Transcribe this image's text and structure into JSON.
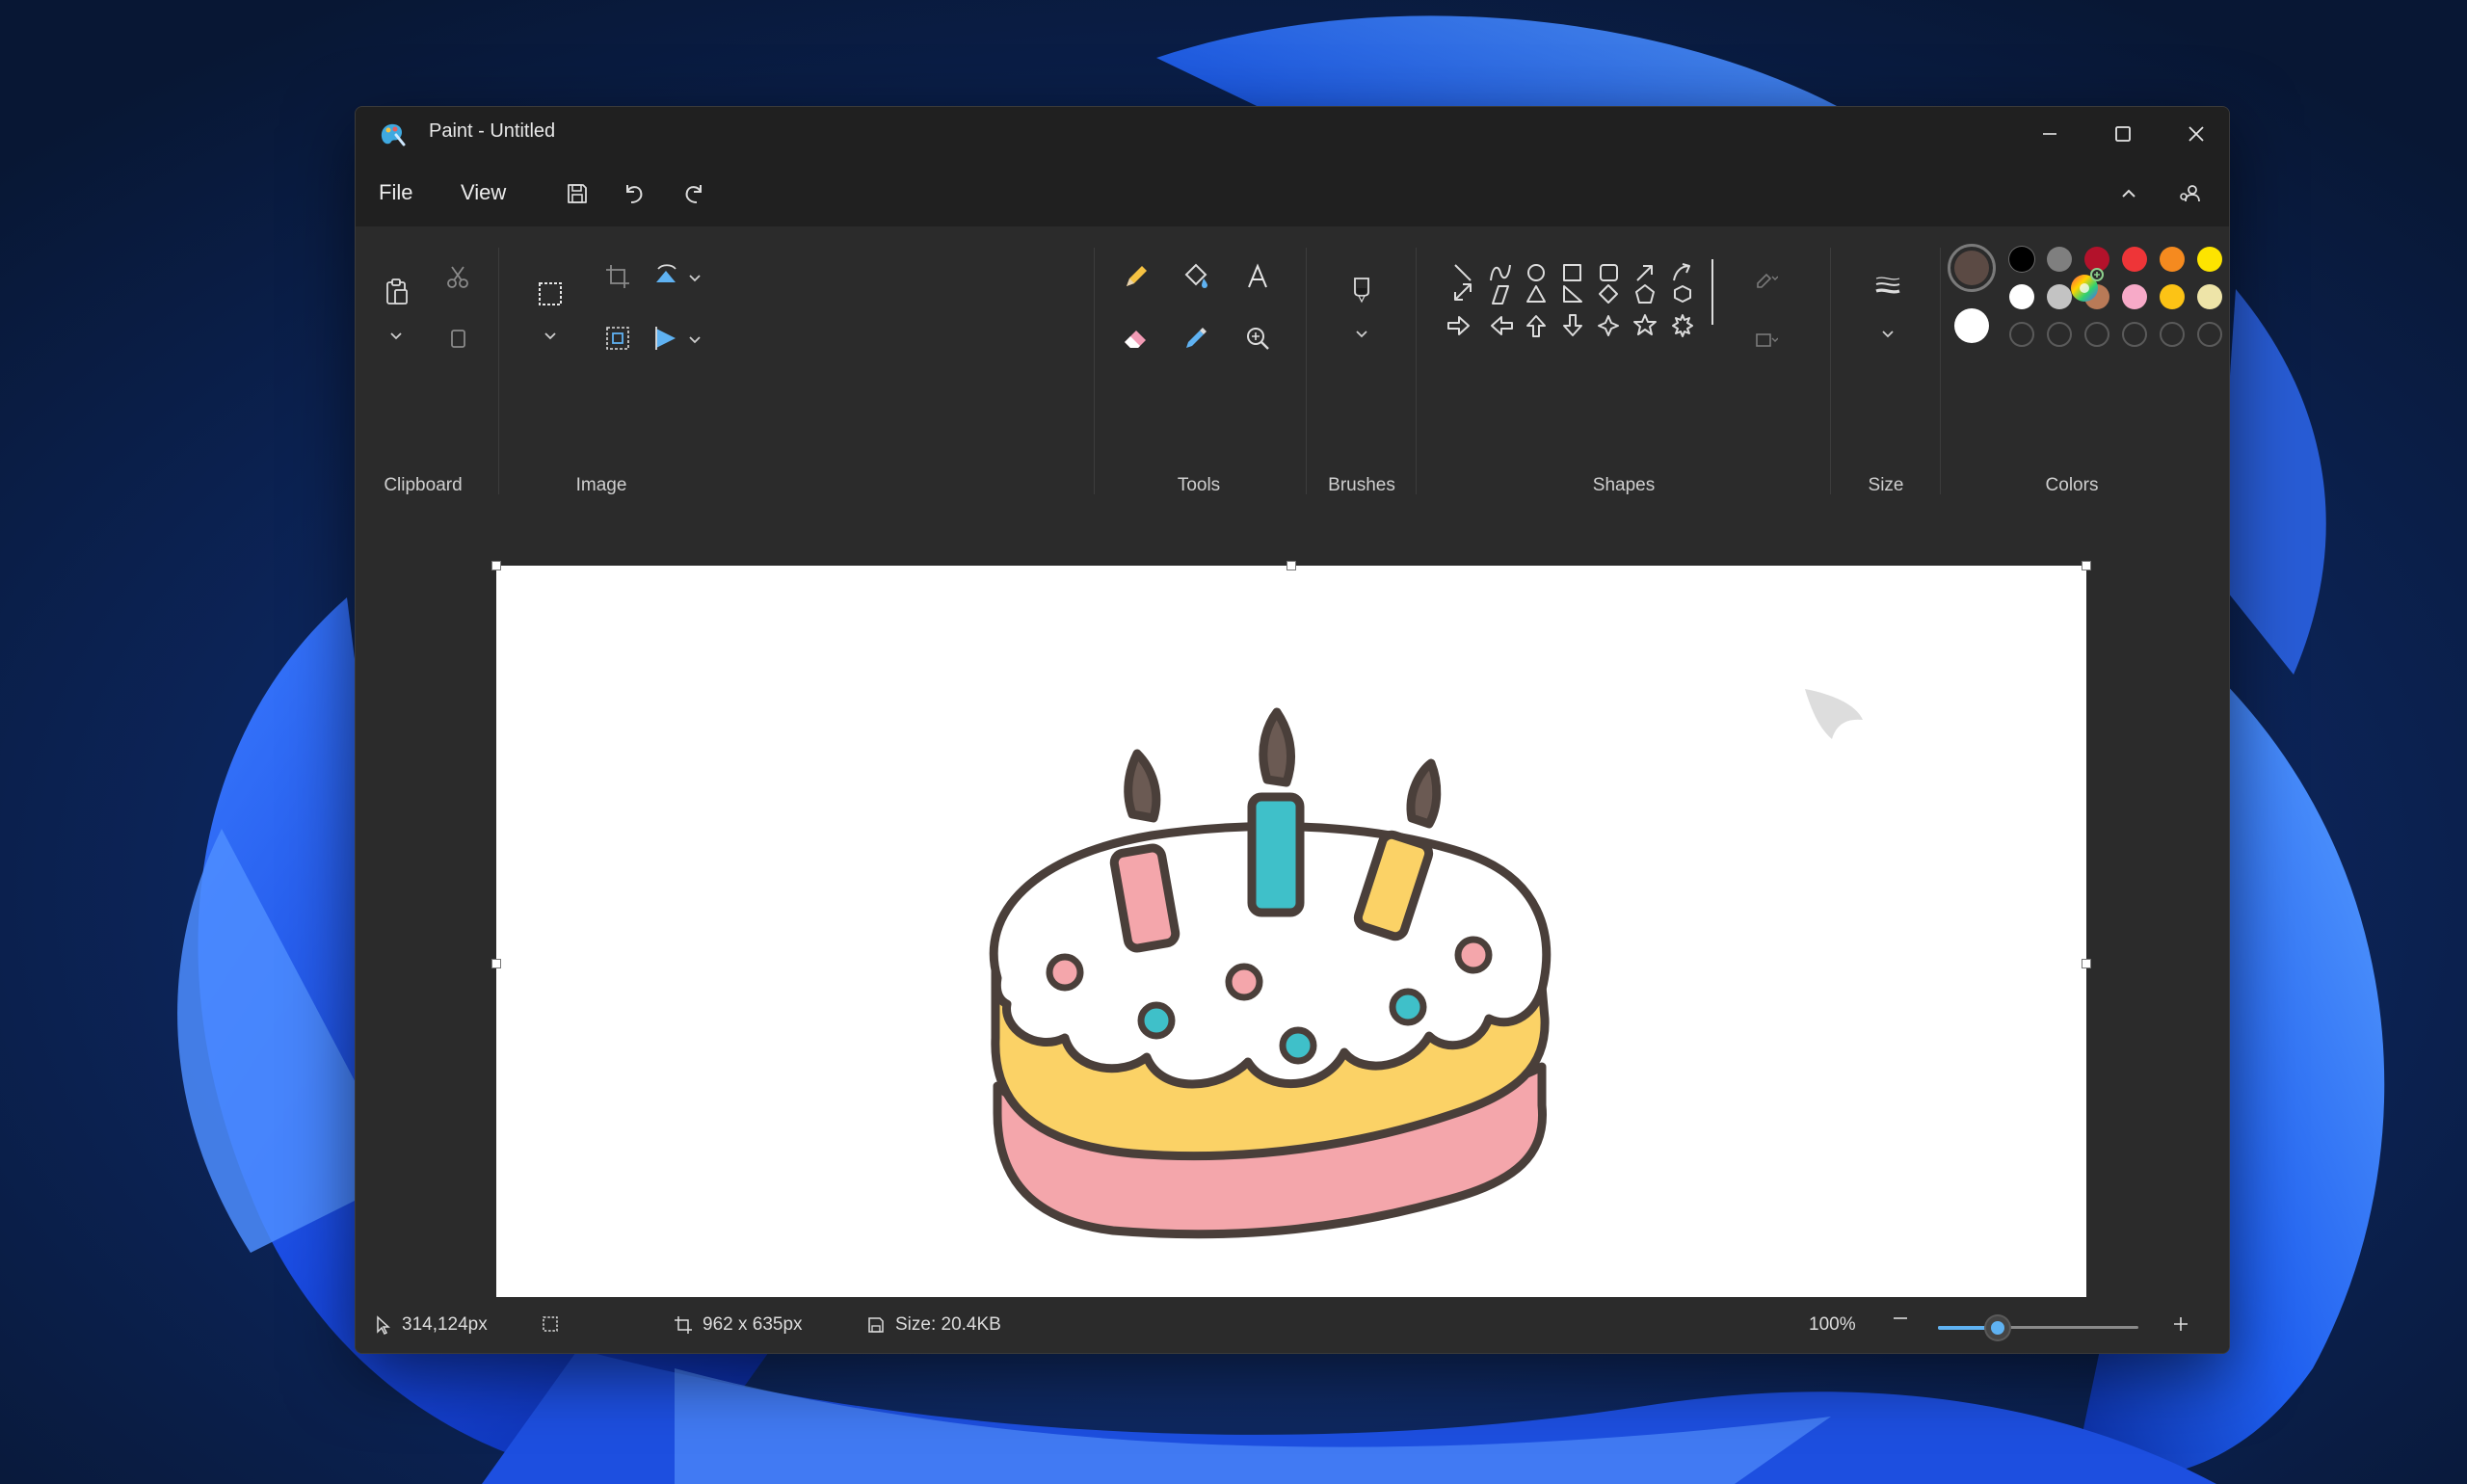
{
  "window": {
    "title": "Paint - Untitled"
  },
  "menu": {
    "file": "File",
    "view": "View"
  },
  "ribbon": {
    "clipboard": "Clipboard",
    "image": "Image",
    "tools": "Tools",
    "brushes": "Brushes",
    "shapes": "Shapes",
    "size": "Size",
    "colors": "Colors"
  },
  "colors": {
    "primary": "#5b4a44",
    "secondary": "#ffffff",
    "palette_row1": [
      "#000000",
      "#7f7f7f",
      "#b3122b",
      "#ee3538",
      "#f58a1f",
      "#fde400",
      "#28b34a",
      "#1fa3e8",
      "#4752cf",
      "#a74fb5"
    ],
    "palette_row2": [
      "#ffffff",
      "#c3c3c3",
      "#b97a57",
      "#f7aac8",
      "#fcc315",
      "#eee4a8",
      "#b5e31c",
      "#98d8ee",
      "#7092c2",
      "#c5bfe6"
    ]
  },
  "status": {
    "cursor": "314,124px",
    "dimensions": "962 x 635px",
    "size": "Size: 20.4KB",
    "zoom": "100%",
    "zoom_fraction": 0.3
  }
}
